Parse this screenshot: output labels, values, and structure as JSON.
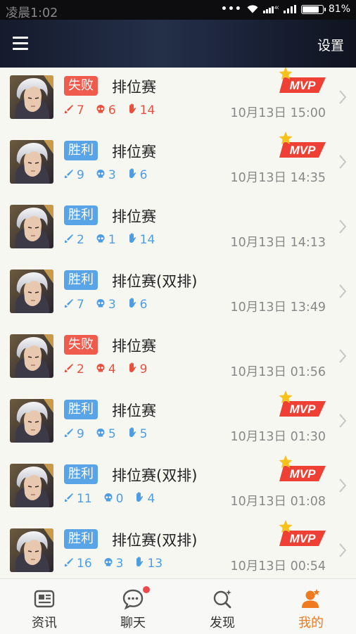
{
  "status_bar": {
    "time": "凌晨1:02",
    "dots": "•••",
    "network": "4G",
    "battery": "81%"
  },
  "header": {
    "settings_label": "设置"
  },
  "colors": {
    "win": "#59a4e6",
    "loss": "#ef5b4c",
    "mvp": "#ef4036",
    "star": "#f6c21b",
    "active_tab": "#f07a1f"
  },
  "matches": [
    {
      "result": "失败",
      "type": "loss",
      "mode": "排位赛",
      "kills": "7",
      "deaths": "6",
      "assists": "14",
      "time": "10月13日 15:00",
      "mvp": true,
      "mvp_label": "MVP"
    },
    {
      "result": "胜利",
      "type": "win",
      "mode": "排位赛",
      "kills": "9",
      "deaths": "3",
      "assists": "6",
      "time": "10月13日 14:35",
      "mvp": true,
      "mvp_label": "MVP"
    },
    {
      "result": "胜利",
      "type": "win",
      "mode": "排位赛",
      "kills": "2",
      "deaths": "1",
      "assists": "14",
      "time": "10月13日 14:13",
      "mvp": false
    },
    {
      "result": "胜利",
      "type": "win",
      "mode": "排位赛(双排)",
      "kills": "7",
      "deaths": "3",
      "assists": "6",
      "time": "10月13日 13:49",
      "mvp": false
    },
    {
      "result": "失败",
      "type": "loss",
      "mode": "排位赛",
      "kills": "2",
      "deaths": "4",
      "assists": "9",
      "time": "10月13日 01:56",
      "mvp": false
    },
    {
      "result": "胜利",
      "type": "win",
      "mode": "排位赛",
      "kills": "9",
      "deaths": "5",
      "assists": "5",
      "time": "10月13日 01:30",
      "mvp": true,
      "mvp_label": "MVP"
    },
    {
      "result": "胜利",
      "type": "win",
      "mode": "排位赛(双排)",
      "kills": "11",
      "deaths": "0",
      "assists": "4",
      "time": "10月13日 01:08",
      "mvp": true,
      "mvp_label": "MVP"
    },
    {
      "result": "胜利",
      "type": "win",
      "mode": "排位赛(双排)",
      "kills": "16",
      "deaths": "3",
      "assists": "13",
      "time": "10月13日 00:54",
      "mvp": true,
      "mvp_label": "MVP"
    }
  ],
  "nav": {
    "items": [
      {
        "label": "资讯",
        "icon": "news-icon",
        "active": false
      },
      {
        "label": "聊天",
        "icon": "chat-icon",
        "active": false,
        "notification": true
      },
      {
        "label": "发现",
        "icon": "discover-icon",
        "active": false
      },
      {
        "label": "我的",
        "icon": "profile-icon",
        "active": true
      }
    ]
  }
}
